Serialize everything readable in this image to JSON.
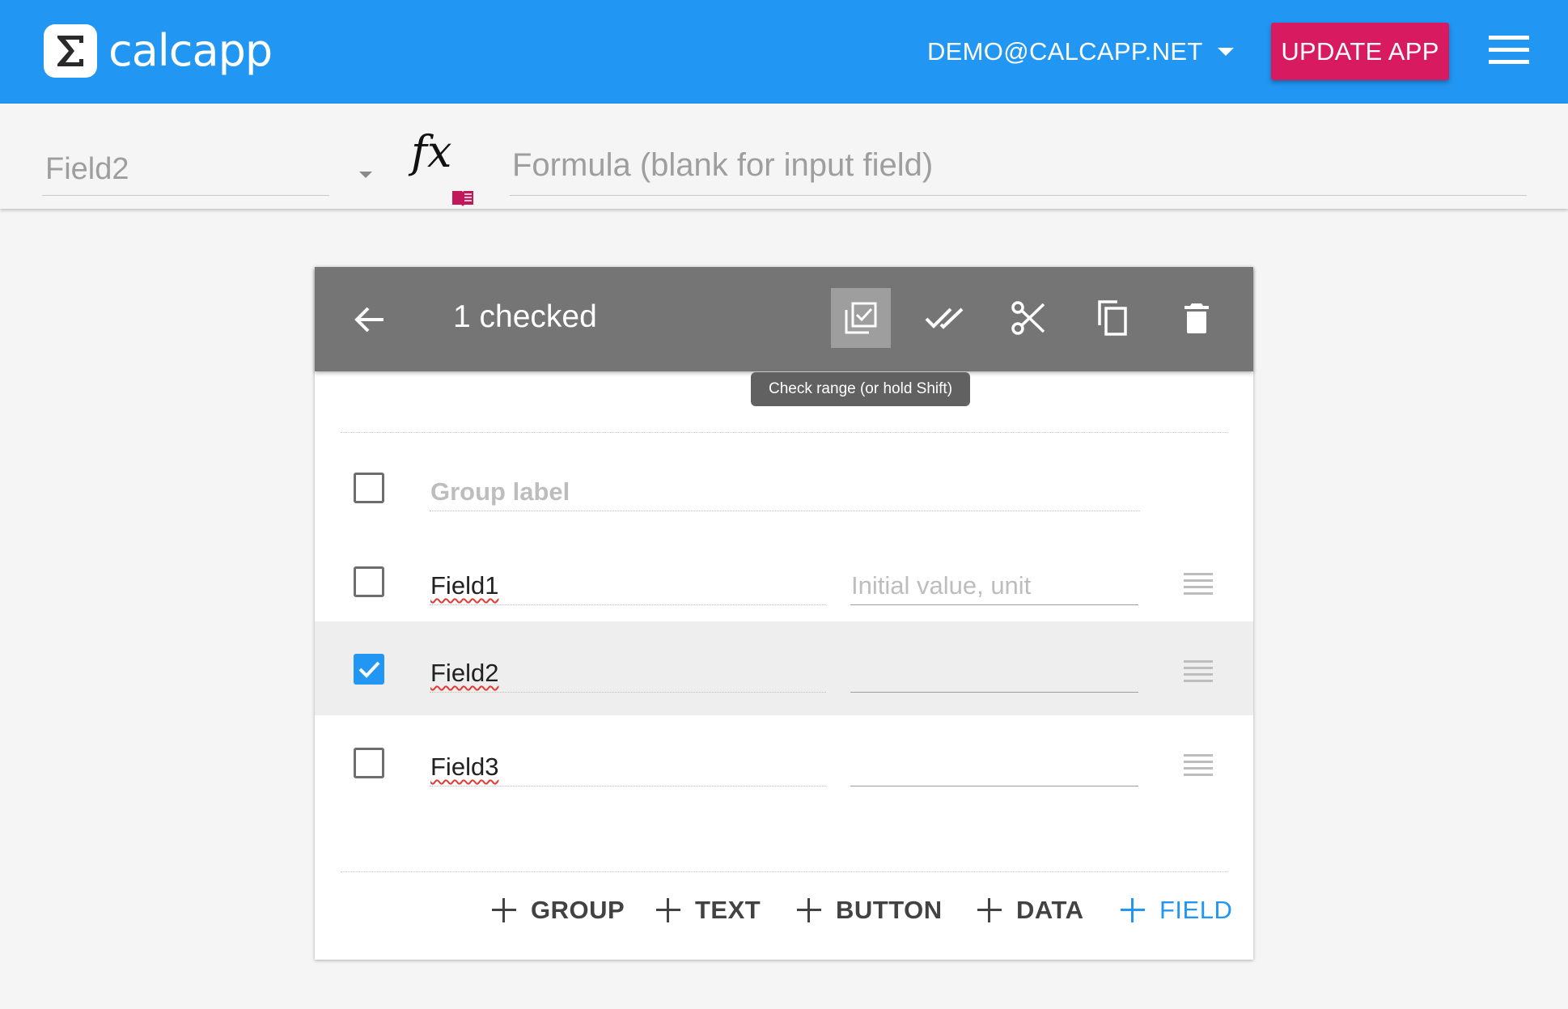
{
  "colors": {
    "appbar": "#2196f3",
    "update_button": "#d81b60",
    "toolbar": "#757575",
    "checkbox_checked": "#2196f3",
    "primary_action": "#2196f3"
  },
  "header": {
    "logo_icon": "sigma-icon",
    "logo_text": "calcapp",
    "account_label": "DEMO@CALCAPP.NET",
    "update_button_label": "UPDATE APP",
    "menu_icon": "hamburger-menu-icon"
  },
  "formula_bar": {
    "selected_field": "Field2",
    "fx_label": "fx",
    "formula_placeholder": "Formula (blank for input field)"
  },
  "selection_toolbar": {
    "title": "1 checked",
    "icons": [
      "back-arrow-icon",
      "check-range-icon",
      "check-all-icon",
      "cut-icon",
      "copy-icon",
      "delete-icon"
    ],
    "tooltip": "Check range (or hold Shift)"
  },
  "rows": [
    {
      "kind": "group",
      "name": "",
      "name_placeholder": "Group label",
      "checked": false
    },
    {
      "kind": "field",
      "name": "Field1",
      "value_placeholder": "Initial value, unit",
      "checked": false
    },
    {
      "kind": "field",
      "name": "Field2",
      "value_placeholder": "",
      "checked": true
    },
    {
      "kind": "field",
      "name": "Field3",
      "value_placeholder": "",
      "checked": false
    }
  ],
  "add_actions": [
    {
      "label": "GROUP",
      "icon": "plus-icon"
    },
    {
      "label": "TEXT",
      "icon": "plus-icon"
    },
    {
      "label": "BUTTON",
      "icon": "plus-icon"
    },
    {
      "label": "DATA",
      "icon": "plus-icon"
    },
    {
      "label": "FIELD",
      "icon": "plus-icon",
      "primary": true
    }
  ]
}
